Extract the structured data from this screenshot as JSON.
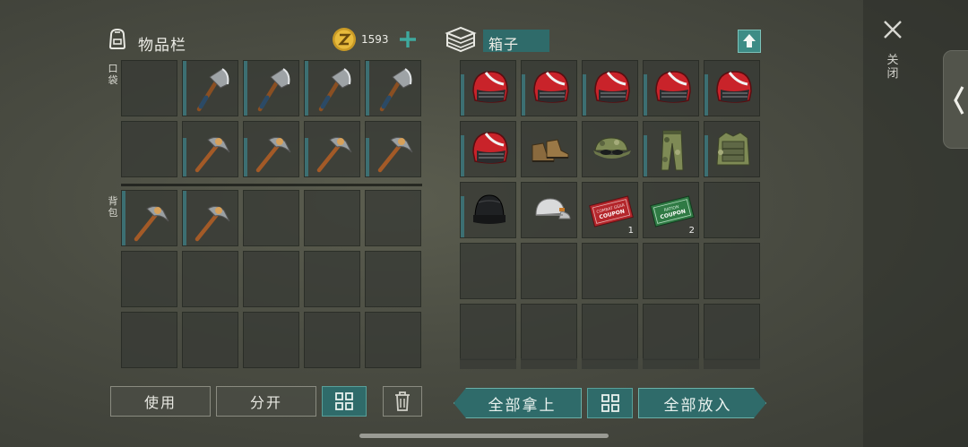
{
  "inventory": {
    "title": "物品栏",
    "currency_amount": "1593",
    "add_icon": "plus-icon",
    "section_pocket": "口袋",
    "section_backpack": "背包",
    "pocket_items": [
      "empty",
      "hatchet",
      "hatchet",
      "hatchet",
      "hatchet",
      "empty",
      "pickaxe",
      "pickaxe",
      "pickaxe",
      "pickaxe"
    ],
    "backpack_items": [
      "pickaxe",
      "pickaxe",
      "empty",
      "empty",
      "empty",
      "empty",
      "empty",
      "empty",
      "empty",
      "empty",
      "empty",
      "empty",
      "empty",
      "empty",
      "empty"
    ]
  },
  "box": {
    "title": "箱子",
    "upload_icon": "arrow-up-icon",
    "items": [
      {
        "type": "helmet"
      },
      {
        "type": "helmet"
      },
      {
        "type": "helmet"
      },
      {
        "type": "helmet"
      },
      {
        "type": "helmet"
      },
      {
        "type": "helmet"
      },
      {
        "type": "boots"
      },
      {
        "type": "cap-camo"
      },
      {
        "type": "pants-camo"
      },
      {
        "type": "vest-camo"
      },
      {
        "type": "beanie"
      },
      {
        "type": "cap-white"
      },
      {
        "type": "coupon-red",
        "qty": "1",
        "text1": "COMBAT GEAR",
        "text2": "COUPON"
      },
      {
        "type": "coupon-green",
        "qty": "2",
        "text1": "RATION",
        "text2": "COUPON"
      },
      {
        "type": "empty"
      },
      {
        "type": "empty"
      },
      {
        "type": "empty"
      },
      {
        "type": "empty"
      },
      {
        "type": "empty"
      },
      {
        "type": "empty"
      },
      {
        "type": "empty"
      },
      {
        "type": "empty"
      },
      {
        "type": "empty"
      },
      {
        "type": "empty"
      },
      {
        "type": "empty"
      }
    ]
  },
  "buttons": {
    "use": "使用",
    "split": "分开",
    "take_all": "全部拿上",
    "put_all": "全部放入"
  },
  "close": {
    "label": "关闭",
    "icon": "close-icon"
  },
  "side_tab_icon": "chevron-left-icon",
  "colors": {
    "accent_teal": "#2f6b6a",
    "durability": "#3c6f72",
    "coin": "#e2b33a"
  }
}
